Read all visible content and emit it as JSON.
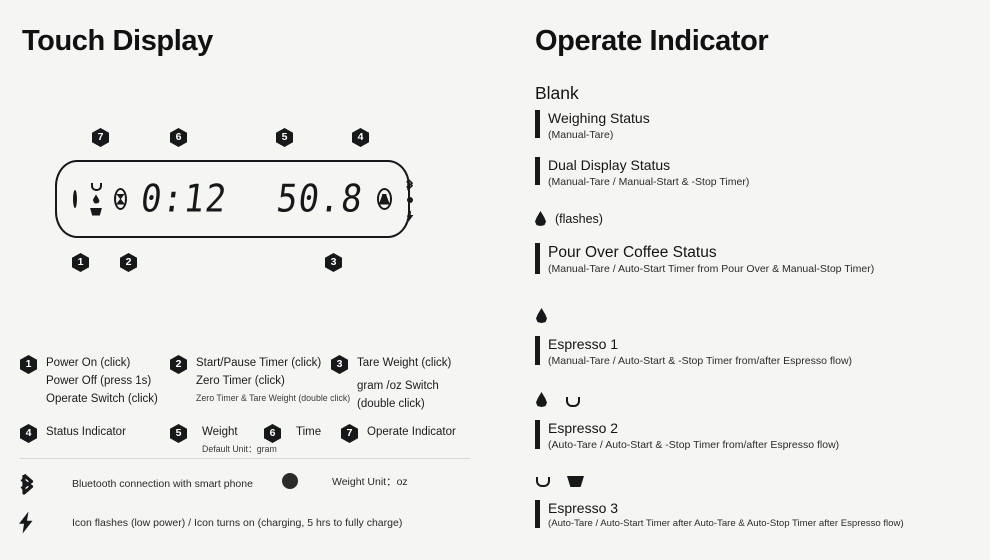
{
  "left_panel": {
    "title": "Touch Display",
    "lcd": {
      "timer_value": "0:12",
      "weight_value": "50.8",
      "icons": {
        "power": "power-circle-icon",
        "cup_outline": "cup-outline-icon",
        "drop": "drop-icon",
        "cup_filled": "cup-filled-icon",
        "timer": "hourglass-circle-icon",
        "weight": "weight-circle-icon",
        "bluetooth": "bluetooth-icon",
        "unit_dot": "weight-unit-dot-icon",
        "battery": "lightning-bolt-icon"
      }
    },
    "callouts_top": [
      {
        "num": "7"
      },
      {
        "num": "6"
      },
      {
        "num": "5"
      },
      {
        "num": "4"
      }
    ],
    "callouts_bottom": [
      {
        "num": "1"
      },
      {
        "num": "2"
      },
      {
        "num": "3"
      }
    ],
    "legend": [
      {
        "num": "1",
        "lines": [
          "Power On (click)",
          "Power Off (press 1s)",
          "Operate Switch (click)"
        ],
        "sublines": []
      },
      {
        "num": "2",
        "lines": [
          "Start/Pause Timer (click)",
          "Zero Timer (click)"
        ],
        "sublines": [
          "Zero Timer & Tare Weight (double click)"
        ]
      },
      {
        "num": "3",
        "lines": [
          "Tare Weight (click)",
          "gram /oz Switch",
          "(double click)"
        ],
        "sublines": []
      },
      {
        "num": "4",
        "lines": [
          "Status Indicator"
        ],
        "sublines": []
      },
      {
        "num": "5",
        "lines": [
          "Weight"
        ],
        "sublines": [
          "Default Unit：gram"
        ]
      },
      {
        "num": "6",
        "lines": [
          "Time"
        ],
        "sublines": []
      },
      {
        "num": "7",
        "lines": [
          "Operate Indicator"
        ],
        "sublines": []
      }
    ],
    "icon_legend": [
      {
        "icon": "bluetooth-icon",
        "text": "Bluetooth connection with smart phone"
      },
      {
        "icon": "weight-unit-dot-icon",
        "text": "Weight Unit：oz"
      },
      {
        "icon": "lightning-bolt-icon",
        "text": "Icon flashes (low power) / Icon turns on (charging, 5 hrs to fully charge)"
      }
    ]
  },
  "right_panel": {
    "title": "Operate Indicator",
    "groups": [
      {
        "heading": "Blank",
        "glyphs": [],
        "items": [
          {
            "title": "Weighing Status",
            "sub": "(Manual-Tare)"
          },
          {
            "title": "Dual Display Status",
            "sub": "(Manual-Tare / Manual-Start & -Stop Timer)"
          }
        ]
      },
      {
        "heading": "",
        "glyphs": [
          "drop-icon"
        ],
        "flash_label": "(flashes)",
        "items": [
          {
            "title": "Pour Over Coffee Status",
            "sub": "(Manual-Tare / Auto-Start Timer from Pour Over & Manual-Stop Timer)"
          }
        ]
      },
      {
        "heading": "",
        "glyphs": [
          "drop-icon"
        ],
        "items": [
          {
            "title": "Espresso 1",
            "sub": "(Manual-Tare / Auto-Start & -Stop Timer from/after Espresso flow)"
          }
        ]
      },
      {
        "heading": "",
        "glyphs": [
          "drop-icon",
          "cup-outline-icon"
        ],
        "items": [
          {
            "title": "Espresso 2",
            "sub": "(Auto-Tare / Auto-Start & -Stop Timer from/after Espresso flow)"
          }
        ]
      },
      {
        "heading": "",
        "glyphs": [
          "cup-outline-icon",
          "cup-filled-icon"
        ],
        "items": [
          {
            "title": "Espresso 3",
            "sub": "(Auto-Tare / Auto-Start Timer after Auto-Tare & Auto-Stop Timer after Espresso flow)"
          }
        ]
      }
    ]
  },
  "colors": {
    "background": "#f5f5f4",
    "ink": "#17181a",
    "subtext": "#2b2b2b"
  }
}
